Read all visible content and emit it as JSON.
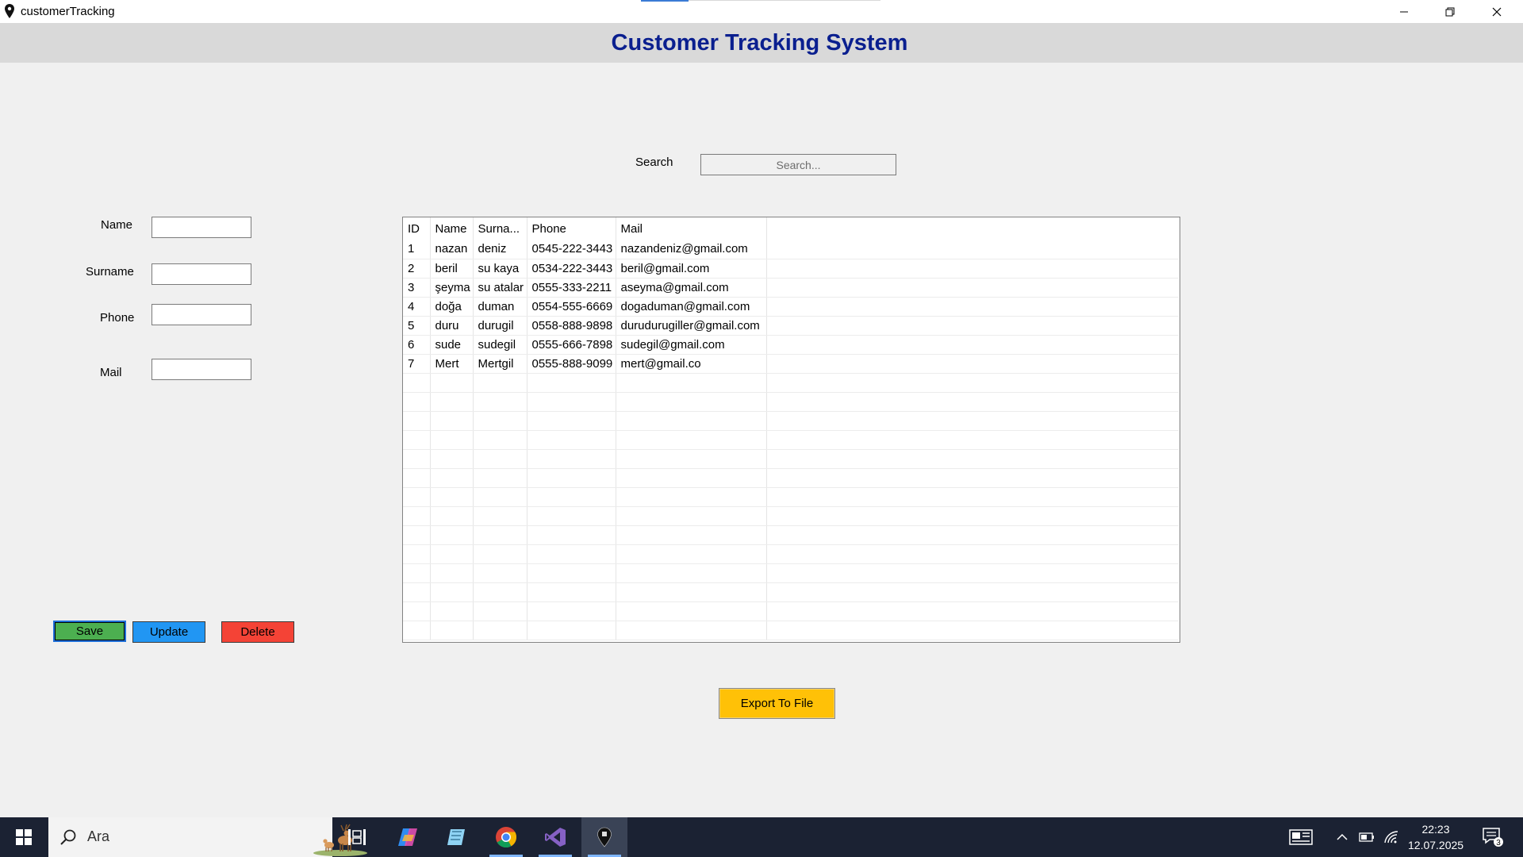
{
  "window": {
    "title": "customerTracking"
  },
  "header": {
    "title": "Customer Tracking System"
  },
  "form": {
    "name_label": "Name",
    "surname_label": "Surname",
    "phone_label": "Phone",
    "mail_label": "Mail",
    "name_value": "",
    "surname_value": "",
    "phone_value": "",
    "mail_value": ""
  },
  "search": {
    "label": "Search",
    "placeholder": "Search...",
    "value": ""
  },
  "buttons": {
    "save": "Save",
    "update": "Update",
    "delete": "Delete",
    "export": "Export To File"
  },
  "grid": {
    "columns": [
      "ID",
      "Name",
      "Surna...",
      "Phone",
      "Mail"
    ],
    "rows": [
      [
        "1",
        "nazan",
        "deniz",
        "0545-222-3443",
        "nazandeniz@gmail.com"
      ],
      [
        "2",
        "beril",
        "su kaya",
        "0534-222-3443",
        "beril@gmail.com"
      ],
      [
        "3",
        "şeyma",
        "su atalar",
        "0555-333-2211",
        "aseyma@gmail.com"
      ],
      [
        "4",
        "doğa",
        "duman",
        "0554-555-6669",
        "dogaduman@gmail.com"
      ],
      [
        "5",
        "duru",
        "durugil",
        "0558-888-9898",
        "durudurugiller@gmail.com"
      ],
      [
        "6",
        "sude",
        "sudegil",
        "0555-666-7898",
        "sudegil@gmail.com"
      ],
      [
        "7",
        "Mert",
        "Mertgil",
        "0555-888-9099",
        "mert@gmail.co"
      ]
    ],
    "empty_rows": 14
  },
  "taskbar": {
    "search_text": "Ara",
    "time": "22:23",
    "date": "12.07.2025",
    "notification_count": "3",
    "apps": [
      "task-view",
      "copilot",
      "files",
      "chrome",
      "visual-studio",
      "customer-tracking"
    ]
  },
  "colors": {
    "header_title": "#0a1f8f",
    "save": "#4caf50",
    "update": "#2196f3",
    "delete": "#f44336",
    "export": "#ffc107",
    "taskbar": "#1b2233"
  }
}
